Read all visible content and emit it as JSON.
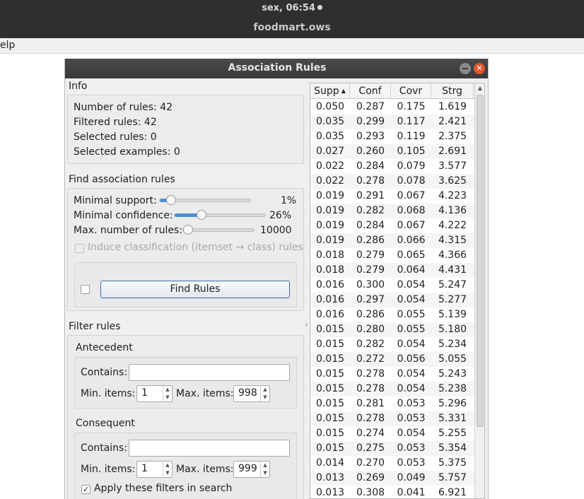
{
  "topbar": {
    "clock": "sex, 06:54",
    "app_title": "foodmart.ows"
  },
  "menubar": {
    "visible_menu": "elp"
  },
  "window": {
    "title": "Association Rules",
    "info": {
      "section": "Info",
      "number_of_rules": "Number of rules: 42",
      "filtered_rules": "Filtered rules: 42",
      "selected_rules": "Selected rules: 0",
      "selected_examples": "Selected examples: 0"
    },
    "find": {
      "section": "Find association rules",
      "min_support_label": "Minimal support:",
      "min_support_value": "1%",
      "min_support_fraction": 0.08,
      "min_confidence_label": "Minimal confidence:",
      "min_confidence_value": "26%",
      "min_confidence_fraction": 0.27,
      "max_rules_label": "Max. number of rules:",
      "max_rules_value": "10000",
      "max_rules_fraction": 0.0,
      "induce_label": "Induce classification (itemset → class) rules",
      "find_button": "Find Rules"
    },
    "filter": {
      "section": "Filter rules",
      "antecedent": {
        "title": "Antecedent",
        "contains_label": "Contains:",
        "contains_value": "",
        "min_items_label": "Min. items:",
        "min_items": "1",
        "max_items_label": "Max. items:",
        "max_items": "998"
      },
      "consequent": {
        "title": "Consequent",
        "contains_label": "Contains:",
        "contains_value": "",
        "min_items_label": "Min. items:",
        "min_items": "1",
        "max_items_label": "Max. items:",
        "max_items": "999"
      },
      "apply_label": "Apply these filters in search",
      "apply_checked": "✓"
    },
    "table": {
      "columns": [
        "Supp",
        "Conf",
        "Covr",
        "Strg"
      ],
      "sort_indicator": "▲",
      "rows": [
        [
          "0.050",
          "0.287",
          "0.175",
          "1.619"
        ],
        [
          "0.035",
          "0.299",
          "0.117",
          "2.421"
        ],
        [
          "0.035",
          "0.293",
          "0.119",
          "2.375"
        ],
        [
          "0.027",
          "0.260",
          "0.105",
          "2.691"
        ],
        [
          "0.022",
          "0.284",
          "0.079",
          "3.577"
        ],
        [
          "0.022",
          "0.278",
          "0.078",
          "3.625"
        ],
        [
          "0.019",
          "0.291",
          "0.067",
          "4.223"
        ],
        [
          "0.019",
          "0.282",
          "0.068",
          "4.136"
        ],
        [
          "0.019",
          "0.284",
          "0.067",
          "4.222"
        ],
        [
          "0.019",
          "0.286",
          "0.066",
          "4.315"
        ],
        [
          "0.018",
          "0.279",
          "0.065",
          "4.366"
        ],
        [
          "0.018",
          "0.279",
          "0.064",
          "4.431"
        ],
        [
          "0.016",
          "0.300",
          "0.054",
          "5.247"
        ],
        [
          "0.016",
          "0.297",
          "0.054",
          "5.277"
        ],
        [
          "0.016",
          "0.286",
          "0.055",
          "5.139"
        ],
        [
          "0.015",
          "0.280",
          "0.055",
          "5.180"
        ],
        [
          "0.015",
          "0.282",
          "0.054",
          "5.234"
        ],
        [
          "0.015",
          "0.272",
          "0.056",
          "5.055"
        ],
        [
          "0.015",
          "0.278",
          "0.054",
          "5.243"
        ],
        [
          "0.015",
          "0.278",
          "0.054",
          "5.238"
        ],
        [
          "0.015",
          "0.281",
          "0.053",
          "5.296"
        ],
        [
          "0.015",
          "0.278",
          "0.053",
          "5.331"
        ],
        [
          "0.015",
          "0.274",
          "0.054",
          "5.255"
        ],
        [
          "0.015",
          "0.275",
          "0.053",
          "5.354"
        ],
        [
          "0.014",
          "0.270",
          "0.053",
          "5.375"
        ],
        [
          "0.013",
          "0.269",
          "0.049",
          "5.757"
        ],
        [
          "0.013",
          "0.308",
          "0.041",
          "6.921"
        ]
      ]
    }
  },
  "colors": {
    "accent": "#4a90d9",
    "close_button": "#e0562b",
    "titlebar": "#3a3a3a"
  }
}
